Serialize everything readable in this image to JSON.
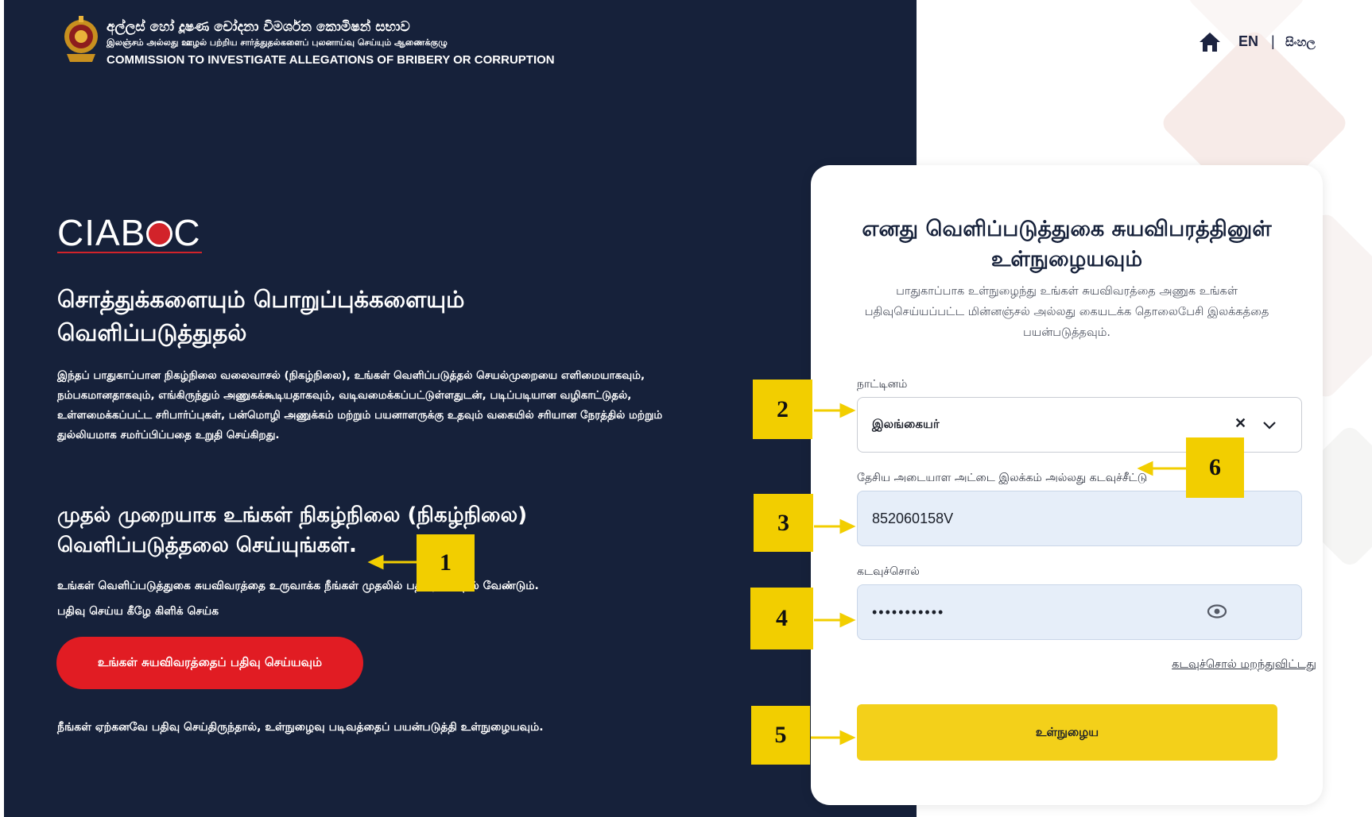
{
  "header": {
    "org_name_sinhala": "අල්ලස් හෝ දූෂණ චෝදනා විමර්ශන කොමිෂන් සභාව",
    "org_name_tamil": "இலஞ்சம் அல்லது ஊழல் பற்றிய சார்த்துதல்களைப் புலனாய்வு செய்யும் ஆணைக்குழு",
    "org_name_english": "COMMISSION TO INVESTIGATE ALLEGATIONS OF BRIBERY OR CORRUPTION",
    "lang_en": "EN",
    "lang_separator": "|",
    "lang_si": "සිංහල"
  },
  "left": {
    "logo_prefix": "CIAB",
    "logo_suffix": "C",
    "heading": "சொத்துக்களையும் பொறுப்புக்களையும் வெளிப்படுத்துதல்",
    "intro": "இந்தப் பாதுகாப்பான நிகழ்நிலை வலைவாசல் (நிகழ்நிலை), உங்கள் வெளிப்படுத்தல் செயல்முறையை எளிமையாகவும், நம்பகமானதாகவும், எங்கிருந்தும் அணுகக்கூடியதாகவும், வடிவமைக்கப்பட்டுள்ளதுடன், படிப்படியான வழிகாட்டுதல், உள்ளமைக்கப்பட்ட சரிபார்ப்புகள், பன்மொழி அணுக்கம் மற்றும் பயனாளருக்கு உதவும் வகையில் சரியான நேரத்தில் மற்றும் துல்லியமாக சமர்ப்பிப்பதை உறுதி செய்கிறது.",
    "first_time_heading": "முதல் முறையாக உங்கள் நிகழ்நிலை (நிகழ்நிலை) வெளிப்படுத்தலை செய்யுங்கள்.",
    "register_text_1": "உங்கள் வெளிப்படுத்துகை சுயவிவரத்தை உருவாக்க நீங்கள் முதலில் பதிவு செய்தல் வேண்டும்.",
    "register_text_2": "பதிவு செய்ய கீழே கிளிக் செய்க",
    "register_button": "உங்கள் சுயவிவரத்தைப் பதிவு செய்யவும்",
    "already_registered": "நீங்கள் ஏற்கனவே பதிவு செய்திருந்தால், உள்நுழைவு படிவத்தைப் பயன்படுத்தி உள்நுழையவும்."
  },
  "login": {
    "title": "எனது வெளிப்படுத்துகை சுயவிபரத்தினுள் உள்நுழையவும்",
    "subtitle": "பாதுகாப்பாக உள்நுழைந்து உங்கள் சுயவிவரத்தை அணுக உங்கள் பதிவுசெய்யப்பட்ட மின்னஞ்சல் அல்லது கையடக்க தொலைபேசி இலக்கத்தை பயன்படுத்தவும்.",
    "nationality_label": "நாட்டினம்",
    "nationality_value": "இலங்கையர்",
    "nic_label": "தேசிய அடையாள அட்டை இலக்கம் அல்லது கடவுச்சீட்டு",
    "nic_value": "852060158V",
    "password_label": "கடவுச்சொல்",
    "password_value": "•••••••••••",
    "forgot_password": "கடவுச்சொல் மறந்துவிட்டது",
    "login_button": "உள்நுழைய"
  },
  "annotations": [
    "1",
    "2",
    "3",
    "4",
    "5",
    "6"
  ],
  "colors": {
    "left_background": "#16213a",
    "accent_red": "#e11c23",
    "accent_yellow": "#f3d01a",
    "annotation_yellow": "#f2ce00",
    "input_fill": "#e6eef9"
  },
  "icons": [
    "emblem-icon",
    "home-icon",
    "clear-icon",
    "chevron-down-icon",
    "eye-icon",
    "arrow-icon"
  ]
}
